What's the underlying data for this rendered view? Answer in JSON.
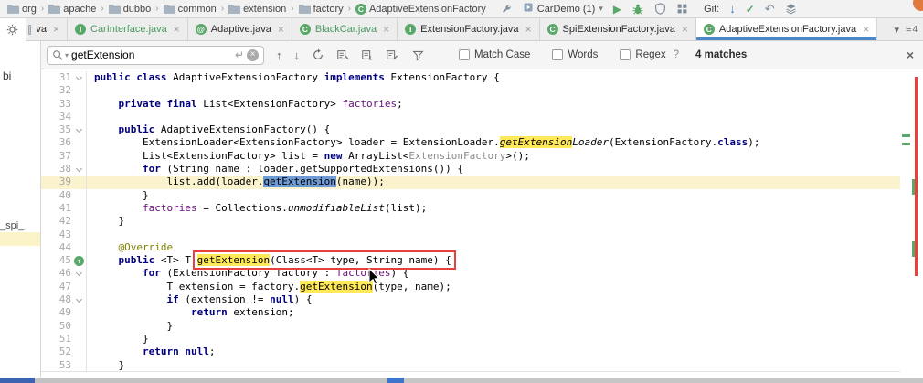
{
  "icons": {
    "class_letter": "C",
    "chevron_down": "▾",
    "play": "▶",
    "check": "✓",
    "arrow_down": "↓",
    "arrow_up": "↑",
    "rollback": "↶",
    "menu": "≡",
    "close": "×",
    "close_small": "×",
    "enter": "↵",
    "up_arrow": "↑"
  },
  "breadcrumbs": {
    "separator": "›",
    "items": [
      {
        "label": "org",
        "icon": "folder"
      },
      {
        "label": "apache",
        "icon": "folder"
      },
      {
        "label": "dubbo",
        "icon": "folder"
      },
      {
        "label": "common",
        "icon": "folder"
      },
      {
        "label": "extension",
        "icon": "folder"
      },
      {
        "label": "factory",
        "icon": "folder"
      },
      {
        "label": "AdaptiveExtensionFactory",
        "icon": "class"
      }
    ]
  },
  "toolbar": {
    "run_config": "CarDemo (1)",
    "git_label": "Git:"
  },
  "tabs": {
    "hidden_count": "4",
    "items": [
      {
        "label": "va",
        "icon": "file",
        "partial": true
      },
      {
        "label": "CarInterface.java",
        "icon": "I",
        "color": "#4C9960"
      },
      {
        "label": "Adaptive.java",
        "icon": "@"
      },
      {
        "label": "BlackCar.java",
        "icon": "C",
        "color": "#4C9960"
      },
      {
        "label": "ExtensionFactory.java",
        "icon": "I"
      },
      {
        "label": "SpiExtensionFactory.java",
        "icon": "C"
      },
      {
        "label": "AdaptiveExtensionFactory.java",
        "icon": "C",
        "active": true
      }
    ]
  },
  "find_bar": {
    "query": "getExtension",
    "match_case_label": "Match Case",
    "words_label": "Words",
    "regex_label": "Regex",
    "help": "?",
    "matches": "4 matches"
  },
  "left_panel": {
    "fragments": [
      "bi",
      "_spi_"
    ]
  },
  "editor": {
    "current_line": 39,
    "lines": [
      {
        "n": 31,
        "g": "fold",
        "seg": [
          {
            "t": "public class ",
            "c": "kw"
          },
          {
            "t": "AdaptiveExtensionFactory "
          },
          {
            "t": "implements",
            "c": "kw"
          },
          {
            "t": " ExtensionFactory {"
          }
        ]
      },
      {
        "n": 32,
        "seg": []
      },
      {
        "n": 33,
        "seg": [
          {
            "t": "    "
          },
          {
            "t": "private final ",
            "c": "kw"
          },
          {
            "t": "List<ExtensionFactory> "
          },
          {
            "t": "factories",
            "c": "field"
          },
          {
            "t": ";"
          }
        ]
      },
      {
        "n": 34,
        "seg": []
      },
      {
        "n": 35,
        "g": "fold",
        "seg": [
          {
            "t": "    "
          },
          {
            "t": "public ",
            "c": "kw"
          },
          {
            "t": "AdaptiveExtensionFactory() {"
          }
        ]
      },
      {
        "n": 36,
        "seg": [
          {
            "t": "        ExtensionLoader<ExtensionFactory> loader = ExtensionLoader."
          },
          {
            "t": "getExtension",
            "c": "static hl"
          },
          {
            "t": "Loader",
            "c": "static"
          },
          {
            "t": "(ExtensionFactory."
          },
          {
            "t": "class",
            "c": "kw"
          },
          {
            "t": ");"
          }
        ]
      },
      {
        "n": 37,
        "seg": [
          {
            "t": "        List<ExtensionFactory> list = "
          },
          {
            "t": "new ",
            "c": "kw"
          },
          {
            "t": "ArrayList<"
          },
          {
            "t": "ExtensionFactory",
            "c": "gray"
          },
          {
            "t": ">();"
          }
        ]
      },
      {
        "n": 38,
        "g": "fold",
        "seg": [
          {
            "t": "        "
          },
          {
            "t": "for ",
            "c": "kw"
          },
          {
            "t": "(String name : loader.getSupportedExtensions()) {"
          }
        ]
      },
      {
        "n": 39,
        "seg": [
          {
            "t": "            list.add(loader."
          },
          {
            "t": "getExtension",
            "c": "sel"
          },
          {
            "t": "(name));"
          }
        ]
      },
      {
        "n": 40,
        "seg": [
          {
            "t": "        }"
          }
        ]
      },
      {
        "n": 41,
        "seg": [
          {
            "t": "        "
          },
          {
            "t": "factories",
            "c": "field"
          },
          {
            "t": " = Collections."
          },
          {
            "t": "unmodifiableList",
            "c": "static"
          },
          {
            "t": "(list);"
          }
        ]
      },
      {
        "n": 42,
        "seg": [
          {
            "t": "    }"
          }
        ]
      },
      {
        "n": 43,
        "seg": []
      },
      {
        "n": 44,
        "seg": [
          {
            "t": "    "
          },
          {
            "t": "@Override",
            "c": "ann"
          }
        ]
      },
      {
        "n": 45,
        "g": "impl",
        "seg": [
          {
            "t": "    "
          },
          {
            "t": "public ",
            "c": "kw"
          },
          {
            "t": "<T> T "
          },
          {
            "t": "getExtension",
            "c": "hl"
          },
          {
            "t": "(Class<T> type, String name) {"
          }
        ]
      },
      {
        "n": 46,
        "g": "fold",
        "seg": [
          {
            "t": "        "
          },
          {
            "t": "for ",
            "c": "kw"
          },
          {
            "t": "(ExtensionFactory factory : "
          },
          {
            "t": "factories",
            "c": "field"
          },
          {
            "t": ") {"
          }
        ]
      },
      {
        "n": 47,
        "seg": [
          {
            "t": "            T extension = factory."
          },
          {
            "t": "getExtension",
            "c": "hl"
          },
          {
            "t": "(type, name);"
          }
        ]
      },
      {
        "n": 48,
        "g": "fold",
        "seg": [
          {
            "t": "            "
          },
          {
            "t": "if ",
            "c": "kw"
          },
          {
            "t": "(extension != "
          },
          {
            "t": "null",
            "c": "kw"
          },
          {
            "t": ") {"
          }
        ]
      },
      {
        "n": 49,
        "seg": [
          {
            "t": "                "
          },
          {
            "t": "return",
            "c": "kw"
          },
          {
            "t": " extension;"
          }
        ]
      },
      {
        "n": 50,
        "seg": [
          {
            "t": "            }"
          }
        ]
      },
      {
        "n": 51,
        "seg": [
          {
            "t": "        }"
          }
        ]
      },
      {
        "n": 52,
        "seg": [
          {
            "t": "        "
          },
          {
            "t": "return null",
            "c": "kw"
          },
          {
            "t": ";"
          }
        ]
      },
      {
        "n": 53,
        "seg": [
          {
            "t": "    }"
          }
        ]
      }
    ]
  }
}
